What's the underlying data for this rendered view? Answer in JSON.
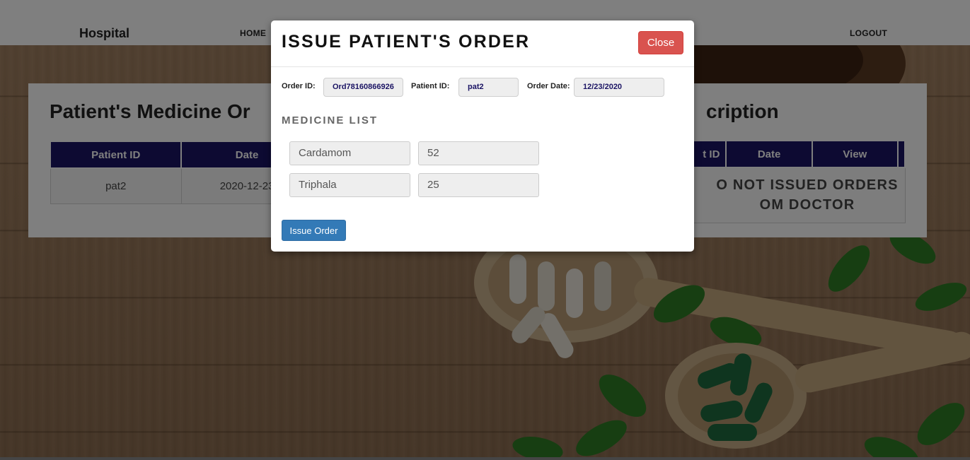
{
  "navbar": {
    "brand": "Hospital",
    "home_label": "HOME",
    "logout_label": "LOGOUT"
  },
  "left_panel": {
    "title": "Patient's Medicine Or",
    "columns": [
      "Patient ID",
      "Date"
    ],
    "rows": [
      {
        "patient_id": "pat2",
        "date": "2020-12-23"
      }
    ]
  },
  "right_panel": {
    "title": "cription",
    "columns": [
      "t ID",
      "Date",
      "View"
    ],
    "empty_message_line1": "O NOT ISSUED ORDERS",
    "empty_message_line2": "OM DOCTOR"
  },
  "modal": {
    "title": "ISSUE PATIENT'S ORDER",
    "close_label": "Close",
    "order_id_label": "Order ID:",
    "order_id": "Ord78160866926",
    "patient_id_label": "Patient ID:",
    "patient_id": "pat2",
    "order_date_label": "Order Date:",
    "order_date": "12/23/2020",
    "medicine_list_title": "MEDICINE LIST",
    "medicines": [
      {
        "name": "Cardamom",
        "quantity": "52"
      },
      {
        "name": "Triphala",
        "quantity": "25"
      }
    ],
    "issue_label": "Issue Order"
  },
  "colors": {
    "table_header": "#1b1464",
    "close_button": "#d9534f",
    "issue_button": "#337ab7"
  }
}
